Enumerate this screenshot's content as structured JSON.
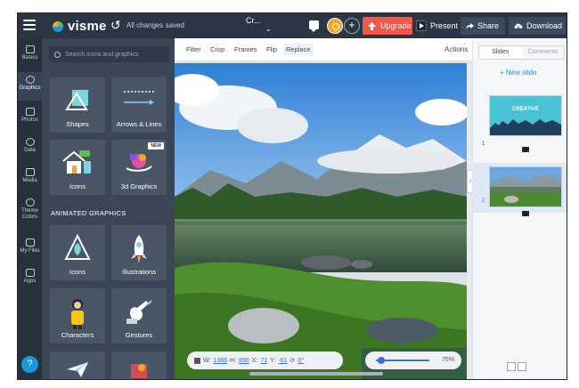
{
  "header": {
    "app_name": "visme",
    "save_status": "All changes saved",
    "doc_title": "Cr...",
    "upgrade_label": "Upgrade",
    "present_label": "Present",
    "share_label": "Share",
    "download_label": "Download"
  },
  "rail": {
    "items": [
      {
        "label": "Basics",
        "icon": "basics-icon"
      },
      {
        "label": "Graphics",
        "icon": "graphics-icon",
        "active": true
      },
      {
        "label": "Photos",
        "icon": "photos-icon"
      },
      {
        "label": "Data",
        "icon": "data-icon"
      },
      {
        "label": "Media",
        "icon": "media-icon"
      },
      {
        "label": "Theme Colors",
        "icon": "theme-colors-icon"
      },
      {
        "label": "My Files",
        "icon": "my-files-icon"
      },
      {
        "label": "Apps",
        "icon": "apps-icon"
      }
    ],
    "help_label": "?"
  },
  "panel": {
    "search_placeholder": "Search icons and graphics",
    "tiles": [
      {
        "label": "Shapes"
      },
      {
        "label": "Arrows & Lines"
      },
      {
        "label": "Icons"
      },
      {
        "label": "3d Graphics",
        "badge": "NEW"
      }
    ],
    "animated_heading": "ANIMATED GRAPHICS",
    "animated_tiles": [
      {
        "label": "Icons"
      },
      {
        "label": "Illustrations"
      },
      {
        "label": "Characters"
      },
      {
        "label": "Gestures"
      }
    ]
  },
  "toolbar": {
    "items": [
      "Filter",
      "Crop",
      "Frames",
      "Flip",
      "Replace"
    ],
    "actions_label": "Actions"
  },
  "stats": {
    "w_label": "W:",
    "w_value": "1366",
    "h_label": "H:",
    "h_value": "890",
    "x_label": "X:",
    "x_value": "71",
    "y_label": "Y:",
    "y_value": "-61",
    "rotation_value": "0°"
  },
  "zoom": {
    "value": "75%",
    "level": 0.75
  },
  "slides": {
    "tabs": [
      "Slides",
      "Comments"
    ],
    "new_slide_label": "+ New slide",
    "items": [
      {
        "number": "1",
        "title": "CREATIVE"
      },
      {
        "number": "2",
        "title": ""
      }
    ]
  },
  "colors": {
    "accent": "#f0594a",
    "link": "#2a93d5",
    "dark_bg": "#2f3a4a"
  }
}
